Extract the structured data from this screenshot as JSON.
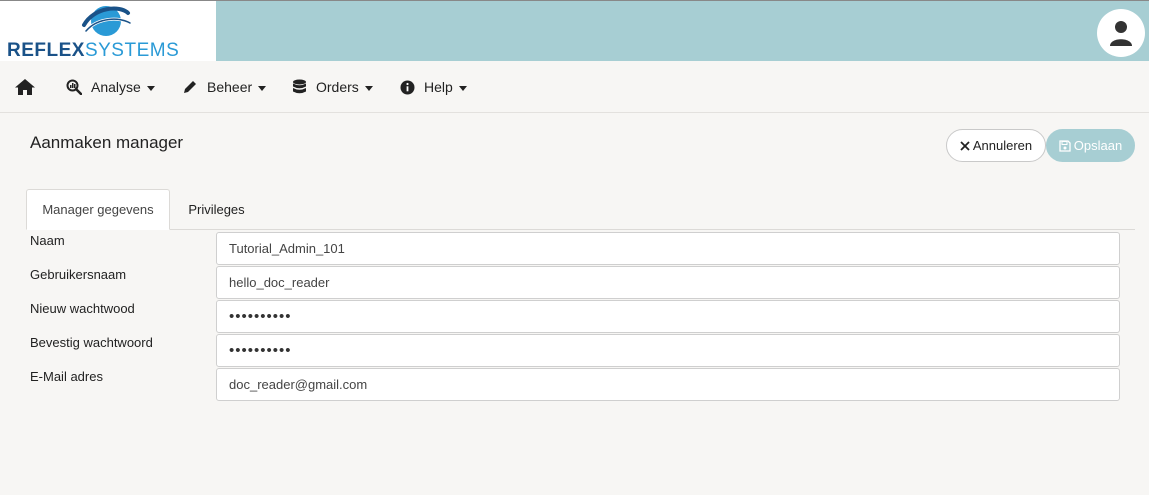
{
  "brand": {
    "name_part1": "REFLEX",
    "name_part2": "SYSTEMS",
    "primary_color": "#1a5288",
    "secondary_color": "#2a9ad6",
    "header_color": "#a7ced3"
  },
  "header": {
    "user_icon": "user-icon"
  },
  "nav": {
    "home_icon": "home-icon",
    "items": [
      {
        "label": "Analyse",
        "icon": "search-chart-icon"
      },
      {
        "label": "Beheer",
        "icon": "pencil-icon"
      },
      {
        "label": "Orders",
        "icon": "database-icon"
      },
      {
        "label": "Help",
        "icon": "info-circle-icon"
      }
    ]
  },
  "page": {
    "title": "Aanmaken manager",
    "cancel_label": "Annuleren",
    "save_label": "Opslaan"
  },
  "tabs": [
    {
      "label": "Manager gegevens",
      "active": true
    },
    {
      "label": "Privileges",
      "active": false
    }
  ],
  "form": {
    "fields": [
      {
        "label": "Naam",
        "value": "Tutorial_Admin_101",
        "type": "text"
      },
      {
        "label": "Gebruikersnaam",
        "value": "hello_doc_reader",
        "type": "text"
      },
      {
        "label": "Nieuw wachtwood",
        "value": "••••••••••",
        "type": "password"
      },
      {
        "label": "Bevestig wachtwoord",
        "value": "••••••••••",
        "type": "password"
      },
      {
        "label": "E-Mail adres",
        "value": "doc_reader@gmail.com",
        "type": "text"
      }
    ]
  }
}
